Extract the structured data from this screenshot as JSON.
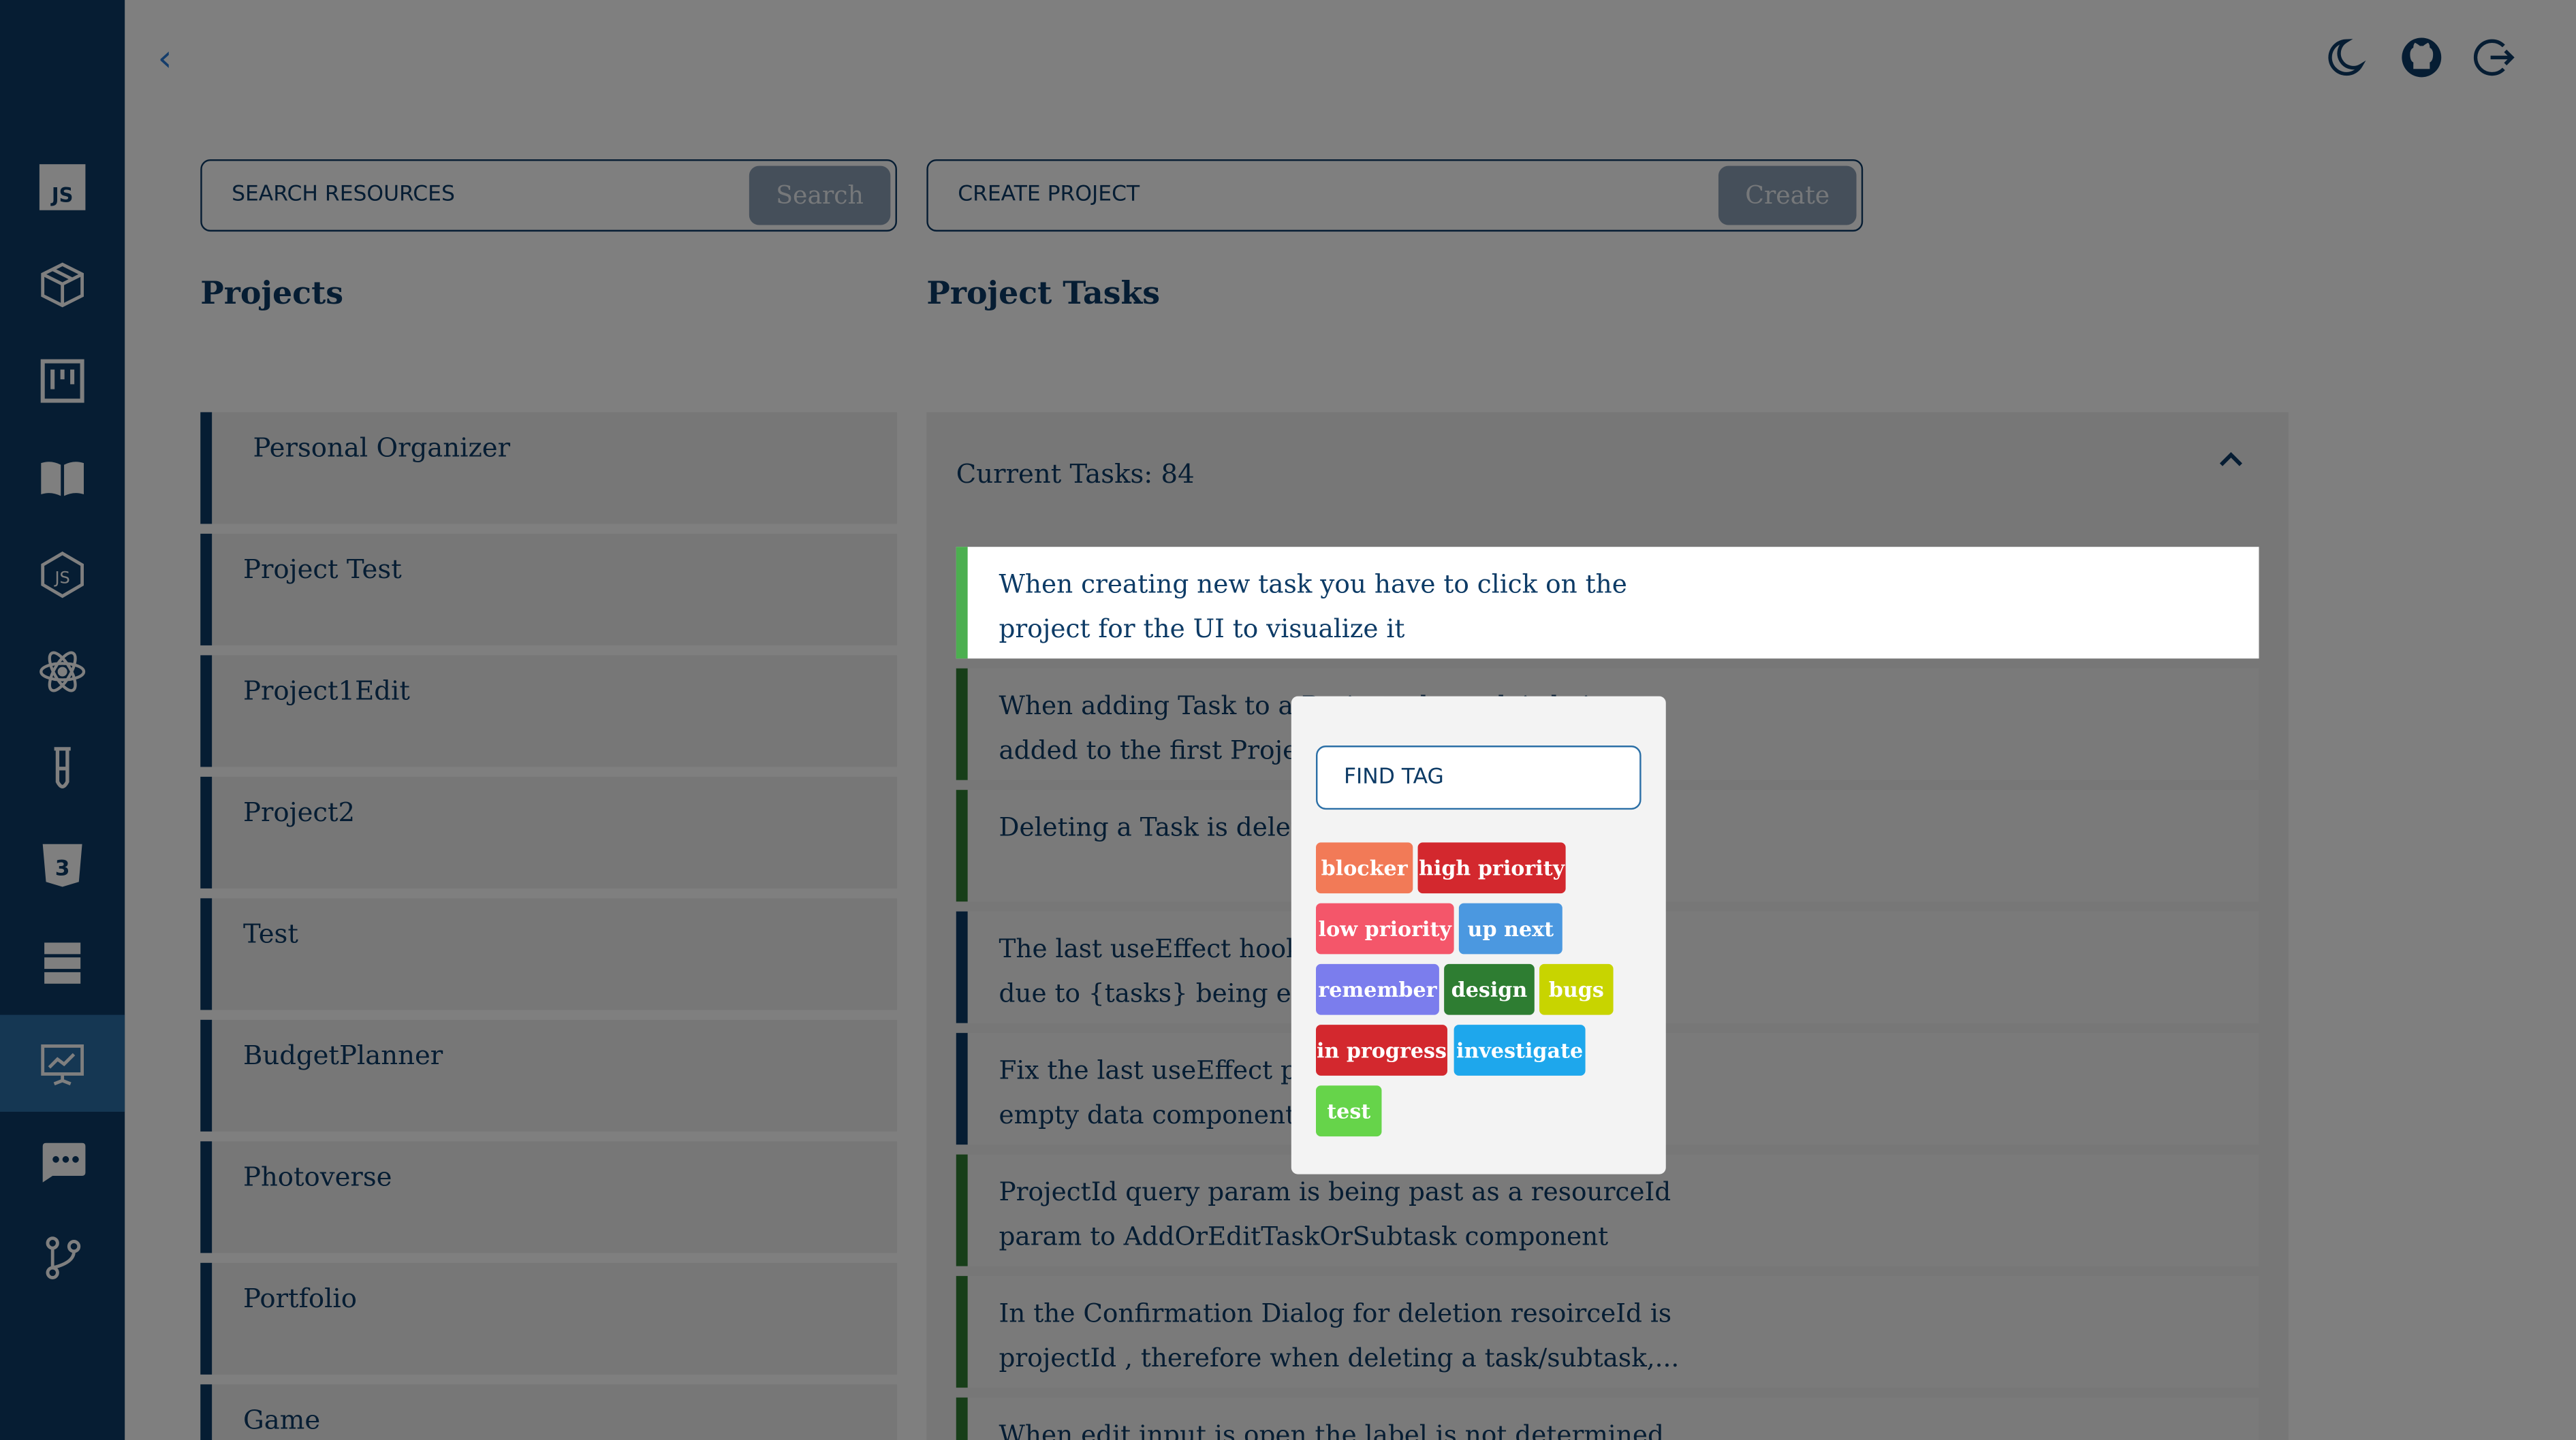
{
  "nav": {
    "back": "‹",
    "items": [
      {
        "name": "javascript"
      },
      {
        "name": "package"
      },
      {
        "name": "kanban"
      },
      {
        "name": "book"
      },
      {
        "name": "nodejs"
      },
      {
        "name": "react"
      },
      {
        "name": "test-tube"
      },
      {
        "name": "css3"
      },
      {
        "name": "server"
      },
      {
        "name": "presentation",
        "active": true
      },
      {
        "name": "chat"
      },
      {
        "name": "git-branch"
      }
    ]
  },
  "header_icons": [
    "moon-icon",
    "github-icon",
    "logout-icon"
  ],
  "search": {
    "placeholder": "SEARCH RESOURCES",
    "button": "Search"
  },
  "create": {
    "placeholder": "CREATE PROJECT",
    "button": "Create"
  },
  "projects": {
    "heading": "Projects",
    "items": [
      "Personal Organizer",
      "Project Test",
      "Project1Edit",
      "Project2",
      "Test",
      "BudgetPlanner",
      "Photoverse",
      "Portfolio",
      "Game"
    ]
  },
  "tasks": {
    "heading": "Project Tasks",
    "current": "Current Tasks: 84",
    "items": [
      "When creating new task you have to click on the\nproject for the UI to visualize it",
      "When adding Task to a Project, the task is being\nadded to the first Project",
      "Deleting a Task is deleting",
      "The last useEffect hook is triggering\ndue to {tasks} being empty",
      "Fix the last useEffect problem\nempty data component/",
      "ProjectId query param is being past as a resourceId\nparam to AddOrEditTaskOrSubtask component",
      "In the Confirmation Dialog for deletion resoirceId is\nprojectId , therefore when deleting a task/subtask,...",
      "When edit input is open the label is not determined"
    ]
  },
  "tag_popup": {
    "placeholder": "FIND TAG",
    "tags": [
      {
        "label": "blocker",
        "color": "#f27a57"
      },
      {
        "label": "high priority",
        "color": "#d3282e"
      },
      {
        "label": "low priority",
        "color": "#f4566a"
      },
      {
        "label": "up next",
        "color": "#4b98e0"
      },
      {
        "label": "remember",
        "color": "#7b7ded"
      },
      {
        "label": "design",
        "color": "#2e7d32"
      },
      {
        "label": "bugs",
        "color": "#c8d400"
      },
      {
        "label": "in progress",
        "color": "#d3282e"
      },
      {
        "label": "investigate",
        "color": "#1ea7ec"
      },
      {
        "label": "test",
        "color": "#66d44a"
      }
    ]
  }
}
